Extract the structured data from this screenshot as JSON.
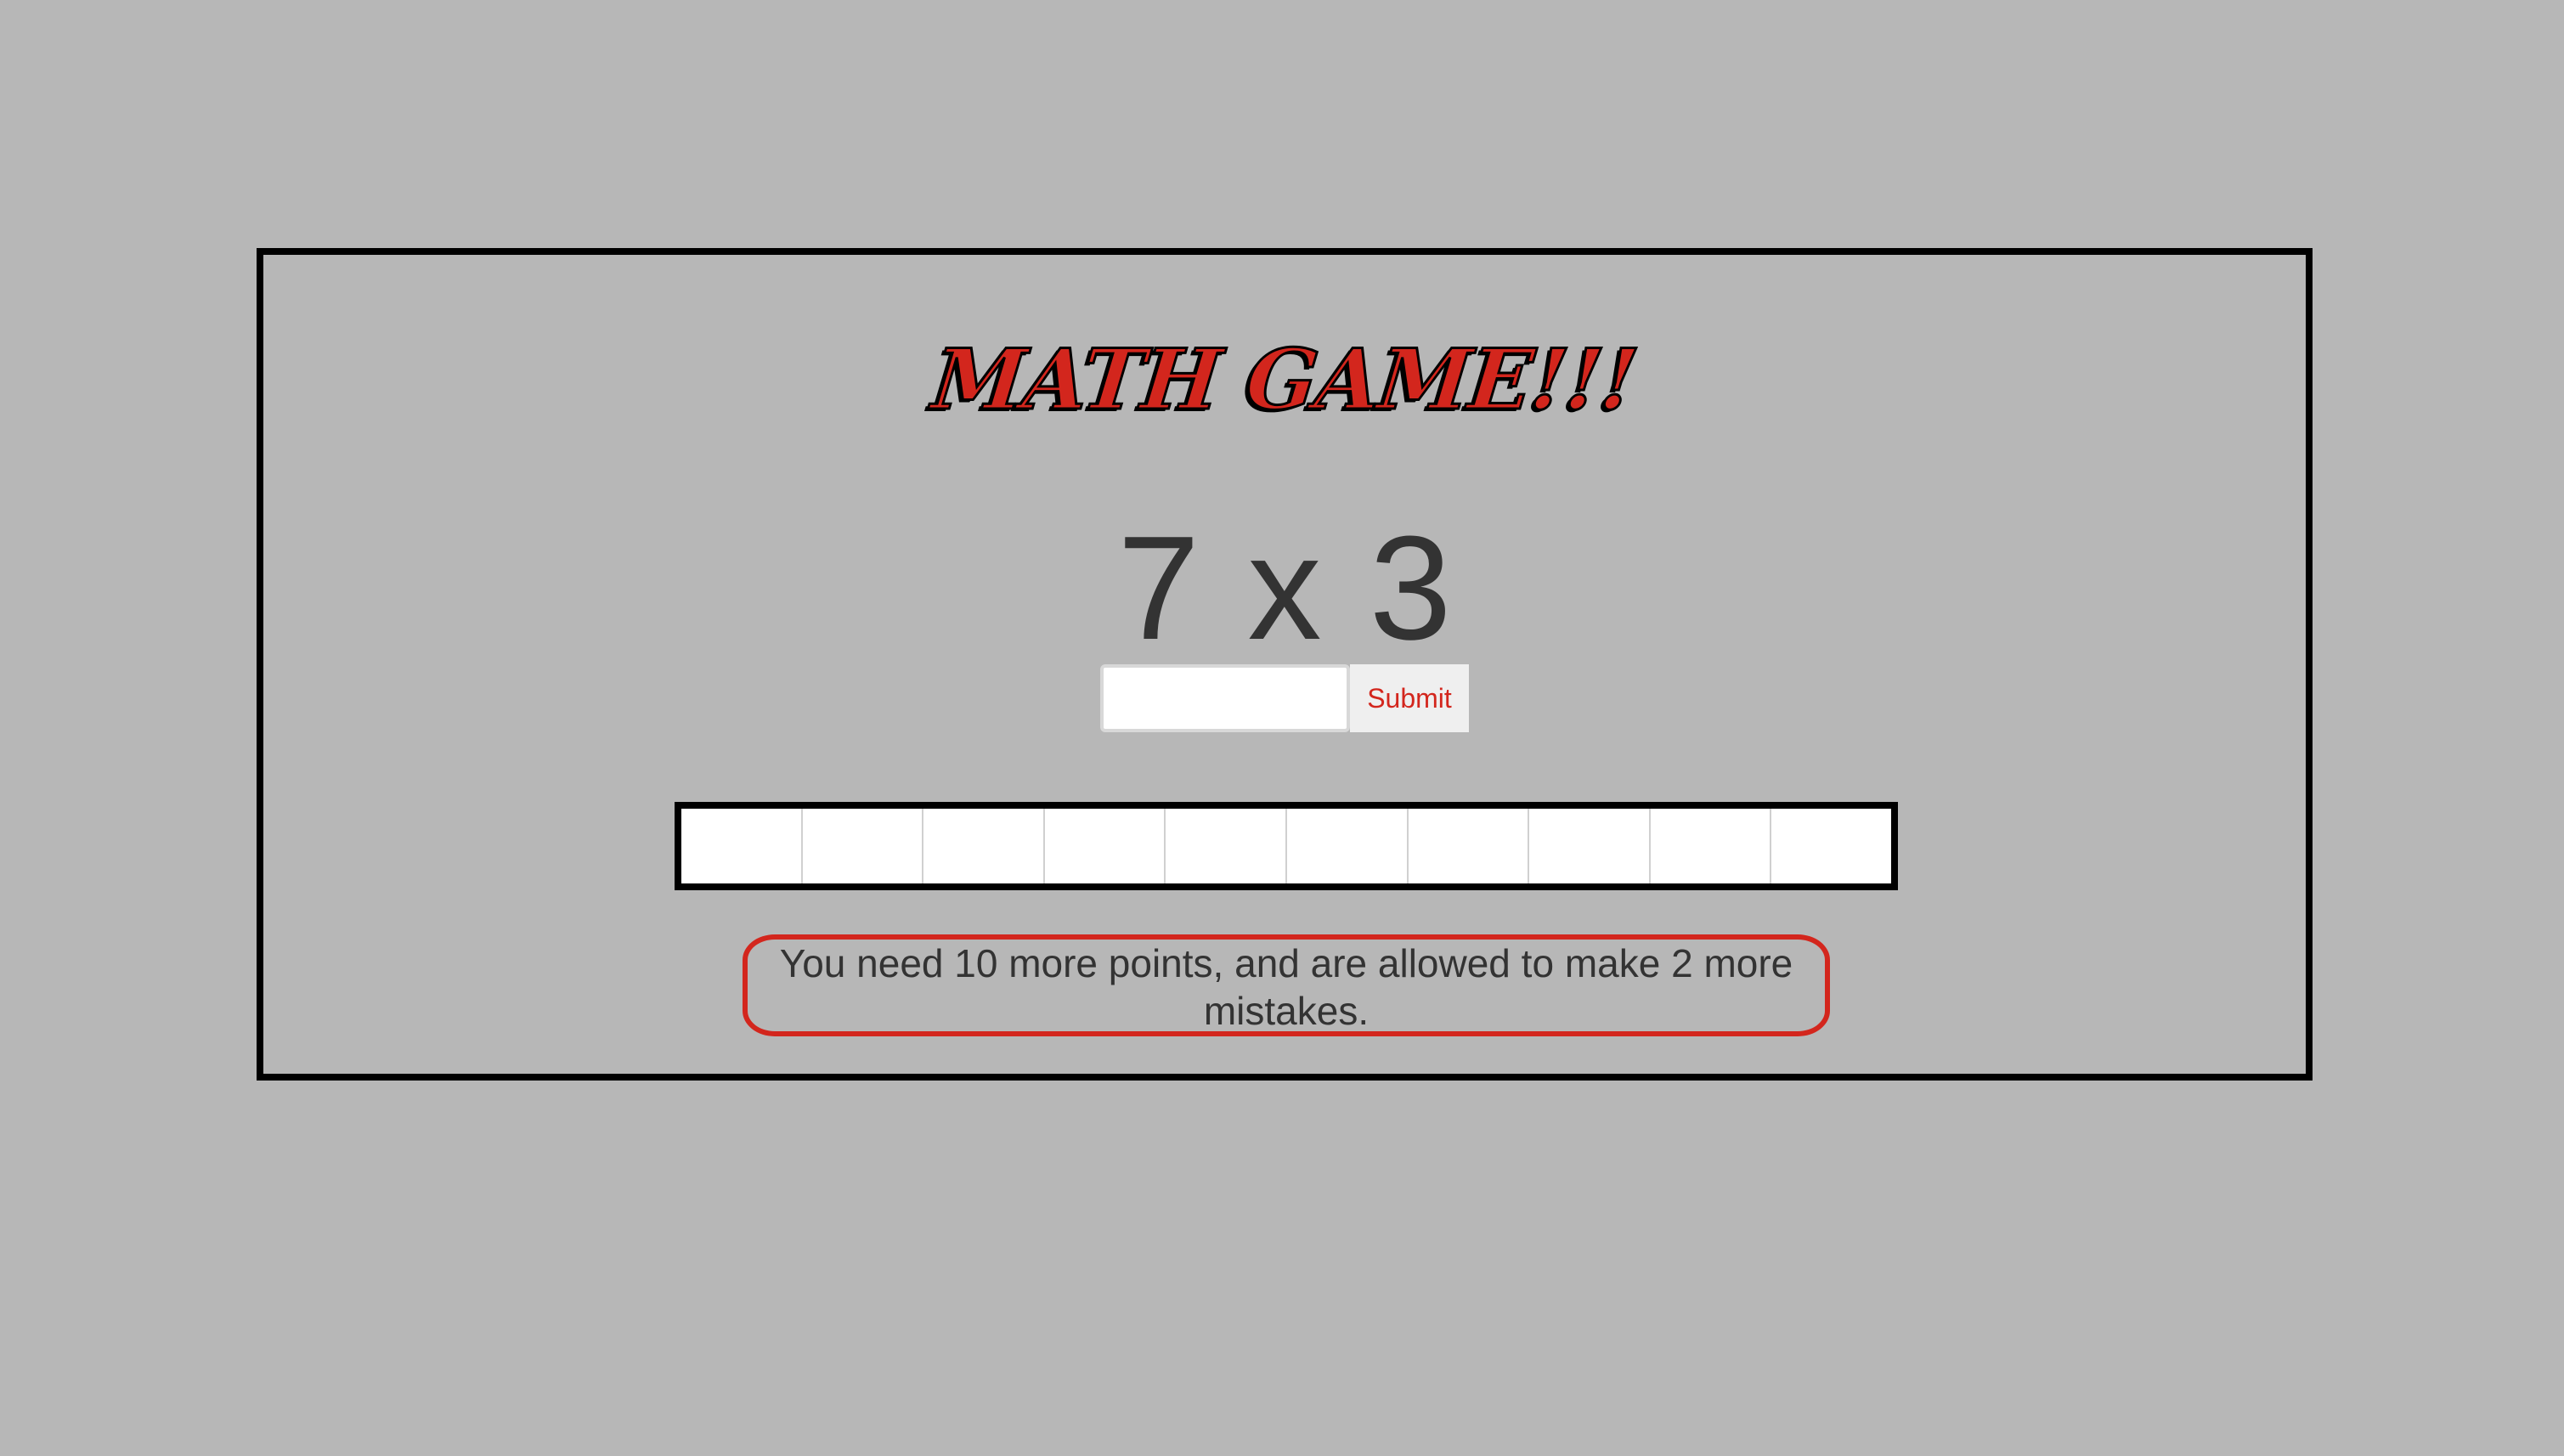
{
  "game": {
    "title": "MATH GAME!!!",
    "problem": "7 x 3",
    "answer_input": {
      "value": "",
      "placeholder": ""
    },
    "submit_label": "Submit",
    "progress": {
      "filled": 0,
      "total": 10
    },
    "status_message": "You need 10 more points, and are allowed to make 2 more mistakes."
  },
  "colors": {
    "background": "#b7b7b7",
    "accent": "#d3261d",
    "text": "#333333",
    "frame": "#000000"
  }
}
